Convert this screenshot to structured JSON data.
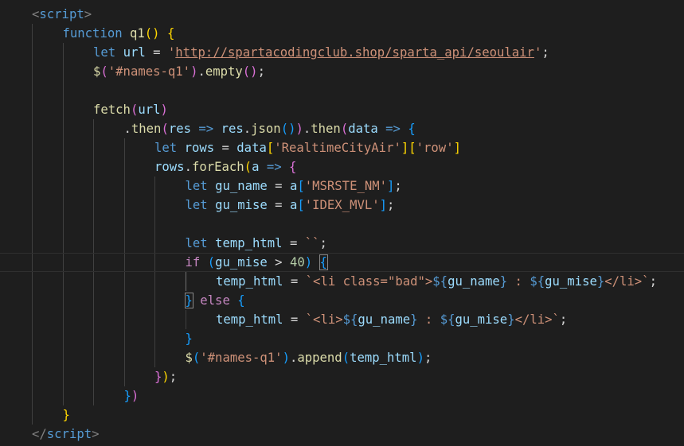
{
  "editor": {
    "lines": [
      [
        [
          "punct",
          "<"
        ],
        [
          "tag",
          "script"
        ],
        [
          "punct",
          ">"
        ]
      ],
      [
        [
          "kw",
          "function"
        ],
        [
          "op",
          " "
        ],
        [
          "fn",
          "q1"
        ],
        [
          "b1",
          "()"
        ],
        [
          "op",
          " "
        ],
        [
          "b1",
          "{"
        ]
      ],
      [
        [
          "kw",
          "let"
        ],
        [
          "op",
          " "
        ],
        [
          "var",
          "url"
        ],
        [
          "op",
          " = "
        ],
        [
          "str",
          "'"
        ],
        [
          "str_u",
          "http://spartacodingclub.shop/sparta_api/seoulair"
        ],
        [
          "str",
          "'"
        ],
        [
          "op",
          ";"
        ]
      ],
      [
        [
          "fn",
          "$"
        ],
        [
          "b2",
          "("
        ],
        [
          "str",
          "'#names-q1'"
        ],
        [
          "b2",
          ")"
        ],
        [
          "op",
          "."
        ],
        [
          "fn",
          "empty"
        ],
        [
          "b2",
          "()"
        ],
        [
          "op",
          ";"
        ]
      ],
      [],
      [
        [
          "fn",
          "fetch"
        ],
        [
          "b2",
          "("
        ],
        [
          "var",
          "url"
        ],
        [
          "b2",
          ")"
        ]
      ],
      [
        [
          "op",
          "."
        ],
        [
          "fn",
          "then"
        ],
        [
          "b2",
          "("
        ],
        [
          "var",
          "res"
        ],
        [
          "op",
          " "
        ],
        [
          "kw",
          "=>"
        ],
        [
          "op",
          " "
        ],
        [
          "var",
          "res"
        ],
        [
          "op",
          "."
        ],
        [
          "fn",
          "json"
        ],
        [
          "b3",
          "()"
        ],
        [
          "b2",
          ")"
        ],
        [
          "op",
          "."
        ],
        [
          "fn",
          "then"
        ],
        [
          "b2",
          "("
        ],
        [
          "var",
          "data"
        ],
        [
          "op",
          " "
        ],
        [
          "kw",
          "=>"
        ],
        [
          "op",
          " "
        ],
        [
          "b3",
          "{"
        ]
      ],
      [
        [
          "kw",
          "let"
        ],
        [
          "op",
          " "
        ],
        [
          "var",
          "rows"
        ],
        [
          "op",
          " = "
        ],
        [
          "var",
          "data"
        ],
        [
          "b1",
          "["
        ],
        [
          "str",
          "'RealtimeCityAir'"
        ],
        [
          "b1",
          "]"
        ],
        [
          "b1",
          "["
        ],
        [
          "str",
          "'row'"
        ],
        [
          "b1",
          "]"
        ]
      ],
      [
        [
          "var",
          "rows"
        ],
        [
          "op",
          "."
        ],
        [
          "fn",
          "forEach"
        ],
        [
          "b1",
          "("
        ],
        [
          "var",
          "a"
        ],
        [
          "op",
          " "
        ],
        [
          "kw",
          "=>"
        ],
        [
          "op",
          " "
        ],
        [
          "b2",
          "{"
        ]
      ],
      [
        [
          "kw",
          "let"
        ],
        [
          "op",
          " "
        ],
        [
          "var",
          "gu_name"
        ],
        [
          "op",
          " = "
        ],
        [
          "var",
          "a"
        ],
        [
          "b3",
          "["
        ],
        [
          "str",
          "'MSRSTE_NM'"
        ],
        [
          "b3",
          "]"
        ],
        [
          "op",
          ";"
        ]
      ],
      [
        [
          "kw",
          "let"
        ],
        [
          "op",
          " "
        ],
        [
          "var",
          "gu_mise"
        ],
        [
          "op",
          " = "
        ],
        [
          "var",
          "a"
        ],
        [
          "b3",
          "["
        ],
        [
          "str",
          "'IDEX_MVL'"
        ],
        [
          "b3",
          "]"
        ],
        [
          "op",
          ";"
        ]
      ],
      [],
      [
        [
          "kw",
          "let"
        ],
        [
          "op",
          " "
        ],
        [
          "var",
          "temp_html"
        ],
        [
          "op",
          " = "
        ],
        [
          "str",
          "``"
        ],
        [
          "op",
          ";"
        ]
      ],
      [
        [
          "ctl",
          "if"
        ],
        [
          "op",
          " "
        ],
        [
          "b3",
          "("
        ],
        [
          "var",
          "gu_mise"
        ],
        [
          "op",
          " > "
        ],
        [
          "num",
          "40"
        ],
        [
          "b3",
          ")"
        ],
        [
          "op",
          " "
        ],
        [
          "b3m",
          "{"
        ]
      ],
      [
        [
          "var",
          "temp_html"
        ],
        [
          "op",
          " = "
        ],
        [
          "str",
          "`<li class=\"bad\">"
        ],
        [
          "tb",
          "${"
        ],
        [
          "var",
          "gu_name"
        ],
        [
          "tb",
          "}"
        ],
        [
          "str",
          " : "
        ],
        [
          "tb",
          "${"
        ],
        [
          "var",
          "gu_mise"
        ],
        [
          "tb",
          "}"
        ],
        [
          "str",
          "</li>`"
        ],
        [
          "op",
          ";"
        ]
      ],
      [
        [
          "b3m",
          "}"
        ],
        [
          "op",
          " "
        ],
        [
          "ctl",
          "else"
        ],
        [
          "op",
          " "
        ],
        [
          "b3",
          "{"
        ]
      ],
      [
        [
          "var",
          "temp_html"
        ],
        [
          "op",
          " = "
        ],
        [
          "str",
          "`<li>"
        ],
        [
          "tb",
          "${"
        ],
        [
          "var",
          "gu_name"
        ],
        [
          "tb",
          "}"
        ],
        [
          "str",
          " : "
        ],
        [
          "tb",
          "${"
        ],
        [
          "var",
          "gu_mise"
        ],
        [
          "tb",
          "}"
        ],
        [
          "str",
          "</li>`"
        ],
        [
          "op",
          ";"
        ]
      ],
      [
        [
          "b3",
          "}"
        ]
      ],
      [
        [
          "fn",
          "$"
        ],
        [
          "b3",
          "("
        ],
        [
          "str",
          "'#names-q1'"
        ],
        [
          "b3",
          ")"
        ],
        [
          "op",
          "."
        ],
        [
          "fn",
          "append"
        ],
        [
          "b3",
          "("
        ],
        [
          "var",
          "temp_html"
        ],
        [
          "b3",
          ")"
        ],
        [
          "op",
          ";"
        ]
      ],
      [
        [
          "b2",
          "}"
        ],
        [
          "b1",
          ")"
        ],
        [
          "op",
          ";"
        ]
      ],
      [
        [
          "b3",
          "}"
        ],
        [
          "b2",
          ")"
        ]
      ],
      [
        [
          "b1",
          "}"
        ]
      ],
      [
        [
          "punct",
          "</"
        ],
        [
          "tag",
          "script"
        ],
        [
          "punct",
          ">"
        ]
      ]
    ],
    "indent": [
      0,
      1,
      2,
      2,
      0,
      2,
      3,
      4,
      4,
      5,
      5,
      0,
      5,
      5,
      6,
      5,
      6,
      5,
      5,
      4,
      3,
      1,
      0
    ],
    "current_line": 13
  }
}
